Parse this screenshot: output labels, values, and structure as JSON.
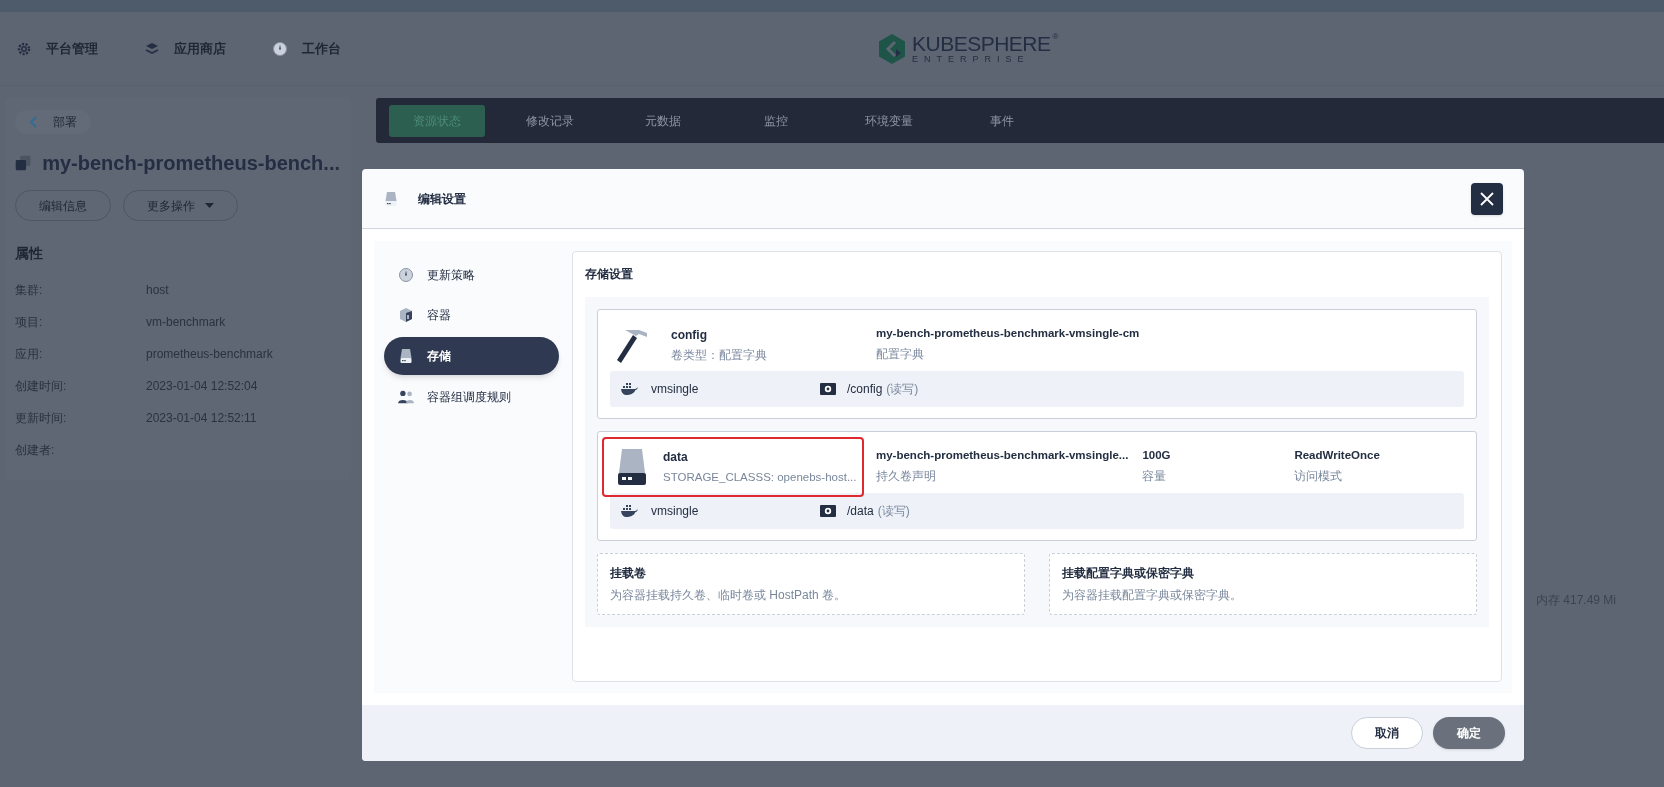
{
  "top_nav": [
    {
      "label": "平台管理"
    },
    {
      "label": "应用商店"
    },
    {
      "label": "工作台"
    }
  ],
  "logo": {
    "name": "KUBESPHERE",
    "mark": "®",
    "edition": "ENTERPRISE"
  },
  "detail": {
    "back": "部署",
    "title": "my-bench-prometheus-bench...",
    "buttons": [
      {
        "label": "编辑信息",
        "dropdown": false
      },
      {
        "label": "更多操作",
        "dropdown": true
      }
    ],
    "section": "属性",
    "props": [
      {
        "label": "集群:",
        "value": "host"
      },
      {
        "label": "项目:",
        "value": "vm-benchmark"
      },
      {
        "label": "应用:",
        "value": "prometheus-benchmark"
      },
      {
        "label": "创建时间:",
        "value": "2023-01-04 12:52:04"
      },
      {
        "label": "更新时间:",
        "value": "2023-01-04 12:52:11"
      },
      {
        "label": "创建者:"
      }
    ]
  },
  "tabs": [
    {
      "label": "资源状态",
      "selected": true
    },
    {
      "label": "修改记录",
      "selected": false
    },
    {
      "label": "元数据",
      "selected": false
    },
    {
      "label": "监控",
      "selected": false
    },
    {
      "label": "环境变量",
      "selected": false
    },
    {
      "label": "事件",
      "selected": false
    }
  ],
  "memory_reading": "内存 417.49 Mi",
  "modal": {
    "title": "编辑设置",
    "steps": [
      {
        "label": "更新策略",
        "selected": false
      },
      {
        "label": "容器",
        "selected": false
      },
      {
        "label": "存储",
        "selected": true
      },
      {
        "label": "容器组调度规则",
        "selected": false
      }
    ],
    "section_title": "存储设置",
    "volumes": [
      {
        "kind": "configmap",
        "name": "config",
        "subtitle": "卷类型：配置字典",
        "highlighted": false,
        "columns": [
          {
            "value": "my-bench-prometheus-benchmark-vmsingle-cm",
            "label": "配置字典"
          }
        ],
        "mounts": [
          {
            "container": "vmsingle",
            "path": "/config",
            "mode": "(读写)"
          }
        ]
      },
      {
        "kind": "pvc",
        "name": "data",
        "subtitle": "STORAGE_CLASSS: openebs-host...",
        "highlighted": true,
        "columns": [
          {
            "value": "my-bench-prometheus-benchmark-vmsingle...",
            "label": "持久卷声明"
          },
          {
            "value": "100G",
            "label": "容量"
          },
          {
            "value": "ReadWriteOnce",
            "label": "访问模式"
          }
        ],
        "mounts": [
          {
            "container": "vmsingle",
            "path": "/data",
            "mode": "(读写)"
          }
        ]
      }
    ],
    "add_options": [
      {
        "title": "挂载卷",
        "description": "为容器挂载持久卷、临时卷或 HostPath 卷。"
      },
      {
        "title": "挂载配置字典或保密字典",
        "description": "为容器挂载配置字典或保密字典。"
      }
    ],
    "cancel": "取消",
    "confirm": "确定"
  }
}
